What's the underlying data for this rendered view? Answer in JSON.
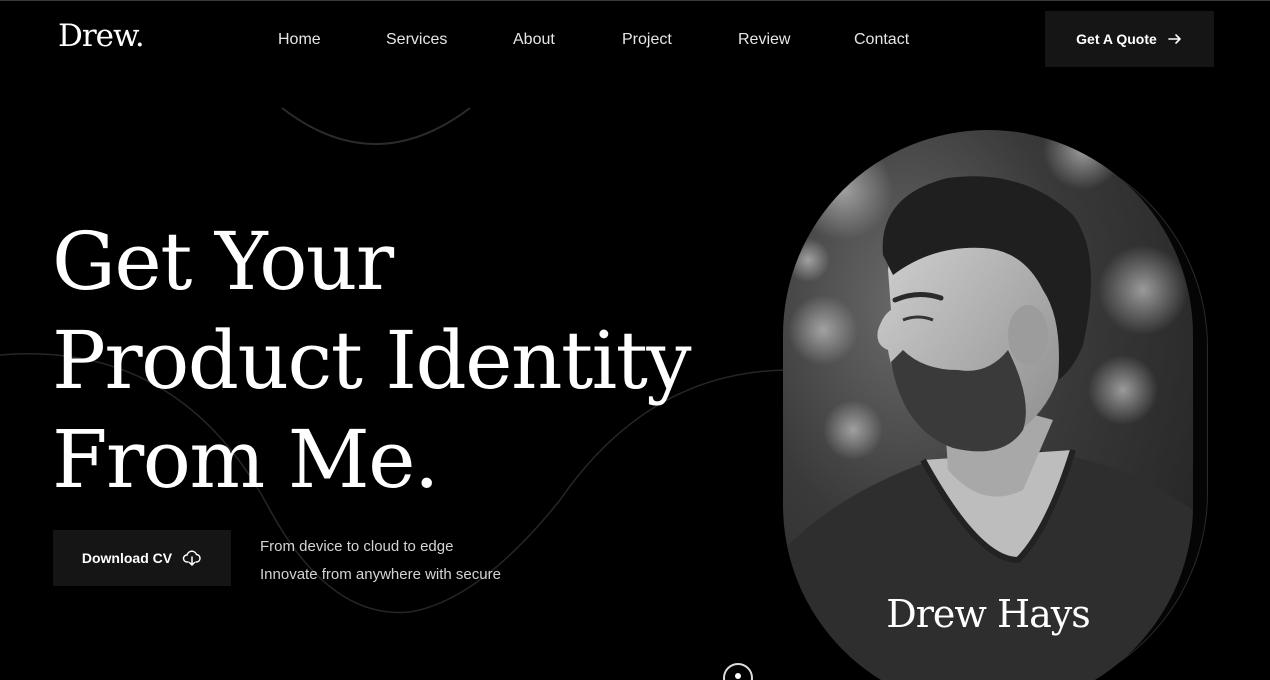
{
  "header": {
    "logo": "Drew.",
    "nav": [
      {
        "label": "Home"
      },
      {
        "label": "Services"
      },
      {
        "label": "About"
      },
      {
        "label": "Project"
      },
      {
        "label": "Review"
      },
      {
        "label": "Contact"
      }
    ],
    "cta_label": "Get A Quote",
    "cta_icon": "arrow-right-icon"
  },
  "hero": {
    "title_lines": [
      "Get Your",
      "Product Identity",
      "From Me."
    ],
    "cv_button_label": "Download CV",
    "cv_button_icon": "cloud-download-icon",
    "tagline": [
      "From device to cloud to edge",
      "Innovate from anywhere with secure"
    ]
  },
  "portrait": {
    "name": "Drew Hays"
  },
  "colors": {
    "background": "#000000",
    "button_bg": "#151515",
    "text": "#ffffff"
  }
}
